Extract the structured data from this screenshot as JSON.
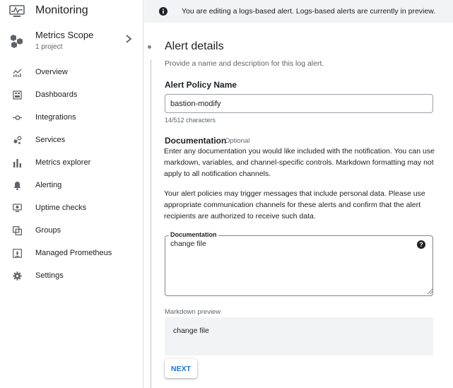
{
  "app": {
    "title": "Monitoring",
    "icon": "monitoring-icon"
  },
  "scope": {
    "title": "Metrics Scope",
    "subtitle": "1 project",
    "icon": "metrics-scope-icon",
    "chevron": "chevron-right-icon"
  },
  "nav": {
    "items": [
      {
        "label": "Overview",
        "icon": "overview-icon"
      },
      {
        "label": "Dashboards",
        "icon": "dashboards-icon"
      },
      {
        "label": "Integrations",
        "icon": "integrations-icon"
      },
      {
        "label": "Services",
        "icon": "services-icon"
      },
      {
        "label": "Metrics explorer",
        "icon": "metrics-explorer-icon"
      },
      {
        "label": "Alerting",
        "icon": "alerting-bell-icon"
      },
      {
        "label": "Uptime checks",
        "icon": "uptime-checks-icon"
      },
      {
        "label": "Groups",
        "icon": "groups-icon"
      },
      {
        "label": "Managed Prometheus",
        "icon": "managed-prometheus-icon"
      },
      {
        "label": "Settings",
        "icon": "gear-icon"
      }
    ]
  },
  "banner": {
    "text": "You are editing a logs-based alert. Logs-based alerts are currently in preview.",
    "icon": "info-icon"
  },
  "form": {
    "title": "Alert details",
    "subtitle": "Provide a name and description for this log alert.",
    "name_label": "Alert Policy Name",
    "name_value": "bastion-modify",
    "char_count": "14/512 characters",
    "doc_heading": "Documentation",
    "doc_optional": "Optional",
    "doc_para1": "Enter any documentation you would like included with the notification. You can use markdown, variables, and channel-specific controls. Markdown formatting may not apply to all notification channels.",
    "doc_para2": "Your alert policies may trigger messages that include personal data. Please use appropriate communication channels for these alerts and confirm that the alert recipients are authorized to receive such data.",
    "doc_field_label": "Documentation",
    "doc_field_value": "change file",
    "help_icon": "help-icon",
    "md_preview_label": "Markdown preview",
    "md_preview_text": "change file",
    "next_label": "NEXT"
  },
  "colors": {
    "accent": "#1a73e8",
    "text": "#202124",
    "secondary_text": "#5f6368",
    "icon": "#5f6368",
    "banner_bg": "#f1f3f4"
  }
}
